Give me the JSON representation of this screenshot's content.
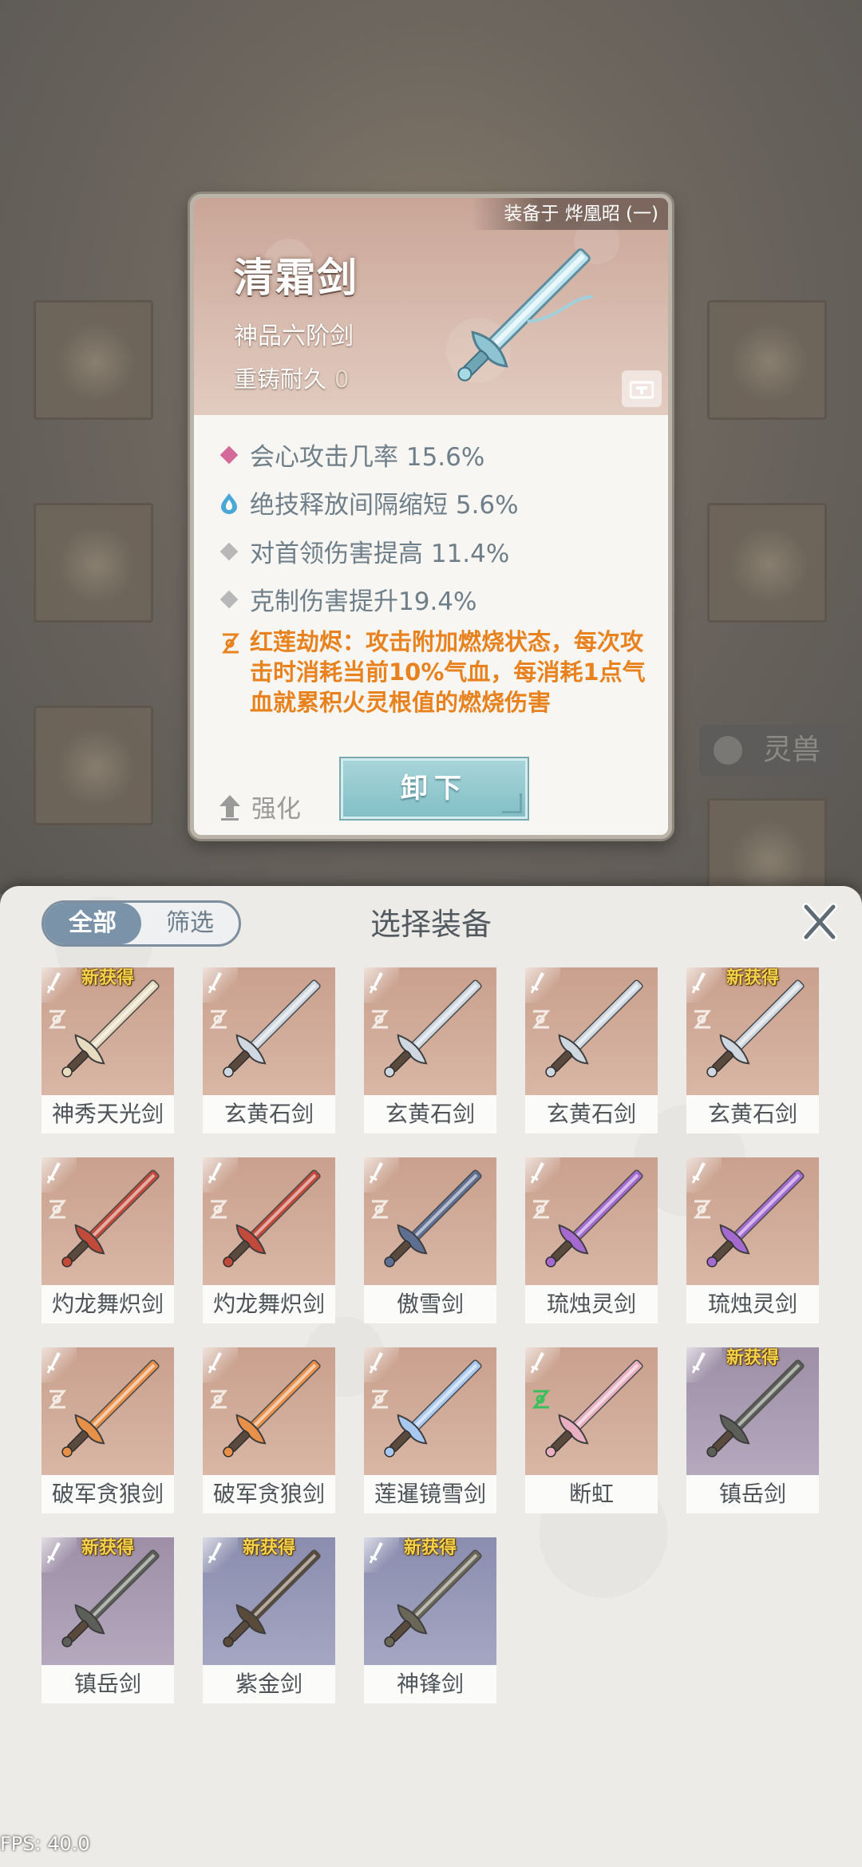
{
  "background": {
    "lingshou_label": "灵兽"
  },
  "detail": {
    "equipped_tag": "装备于 烨凰昭 (一)",
    "name": "清霜剑",
    "grade": "神品六阶剑",
    "recast_label": "重铸耐久",
    "recast_value": "0",
    "attributes": [
      {
        "icon": "pink-diamond-icon",
        "color": "#d46a9a",
        "text": "会心攻击几率 15.6%"
      },
      {
        "icon": "water-drop-icon",
        "color": "#4aa8d8",
        "text": "绝技释放间隔缩短 5.6%"
      },
      {
        "icon": "gray-diamond-icon",
        "color": "#b8b8b8",
        "text": "对首领伤害提高 11.4%"
      },
      {
        "icon": "gray-diamond-icon",
        "color": "#b8b8b8",
        "text": "克制伤害提升19.4%"
      }
    ],
    "special": {
      "icon": "flame-rune-icon",
      "text": "红莲劫烬：攻击附加燃烧状态，每次攻击时消耗当前10%气血，每消耗1点气血就累积火灵根值的燃烧伤害"
    },
    "enhance_label": "强化",
    "unequip_label": "卸下"
  },
  "panel": {
    "title": "选择装备",
    "tabs": [
      {
        "label": "全部",
        "selected": true
      },
      {
        "label": "筛选",
        "selected": false
      }
    ],
    "items": [
      {
        "name": "神秀天光剑",
        "new": true,
        "badge": "新获得",
        "tier": "legend",
        "sword_color": "#e8dcc0"
      },
      {
        "name": "玄黄石剑",
        "new": false,
        "badge": "",
        "tier": "legend",
        "sword_color": "#cfd8e0"
      },
      {
        "name": "玄黄石剑",
        "new": false,
        "badge": "",
        "tier": "legend",
        "sword_color": "#cfd8e0"
      },
      {
        "name": "玄黄石剑",
        "new": false,
        "badge": "",
        "tier": "legend",
        "sword_color": "#cfd8e0"
      },
      {
        "name": "玄黄石剑",
        "new": true,
        "badge": "新获得",
        "tier": "legend",
        "sword_color": "#cfd8e0"
      },
      {
        "name": "灼龙舞炽剑",
        "new": false,
        "badge": "",
        "tier": "legend",
        "sword_color": "#c24a3a"
      },
      {
        "name": "灼龙舞炽剑",
        "new": false,
        "badge": "",
        "tier": "legend",
        "sword_color": "#c24a3a"
      },
      {
        "name": "傲雪剑",
        "new": false,
        "badge": "",
        "tier": "legend",
        "sword_color": "#5f6f92"
      },
      {
        "name": "琉烛灵剑",
        "new": false,
        "badge": "",
        "tier": "legend",
        "sword_color": "#a46ad0"
      },
      {
        "name": "琉烛灵剑",
        "new": false,
        "badge": "",
        "tier": "legend",
        "sword_color": "#a46ad0"
      },
      {
        "name": "破军贪狼剑",
        "new": false,
        "badge": "",
        "tier": "legend",
        "sword_color": "#e7904a"
      },
      {
        "name": "破军贪狼剑",
        "new": false,
        "badge": "",
        "tier": "legend",
        "sword_color": "#e7904a"
      },
      {
        "name": "莲暹镜雪剑",
        "new": false,
        "badge": "",
        "tier": "legend",
        "sword_color": "#a8c8f0"
      },
      {
        "name": "断虹",
        "new": false,
        "badge": "",
        "tier": "legend",
        "sword_color": "#e8b0c0"
      },
      {
        "name": "镇岳剑",
        "new": true,
        "badge": "新获得",
        "tier": "rare",
        "sword_color": "#5c5f58"
      },
      {
        "name": "镇岳剑",
        "new": true,
        "badge": "新获得",
        "tier": "rare",
        "sword_color": "#5c5f58"
      },
      {
        "name": "紫金剑",
        "new": true,
        "badge": "新获得",
        "tier": "epic",
        "sword_color": "#5a4a3a"
      },
      {
        "name": "神锋剑",
        "new": true,
        "badge": "新获得",
        "tier": "epic",
        "sword_color": "#6a6658"
      }
    ]
  },
  "fps": "FPS: 40.0"
}
